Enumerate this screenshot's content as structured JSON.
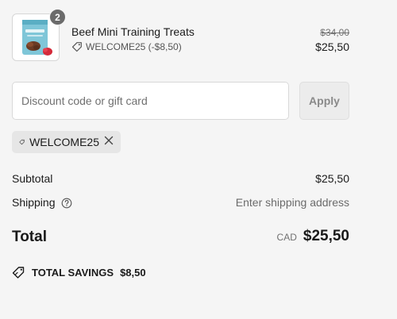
{
  "product": {
    "quantity": "2",
    "name": "Beef Mini Training Treats",
    "discount_label": "WELCOME25 (-$8,50)",
    "original_price": "$34,00",
    "price": "$25,50",
    "thumbnail_icon": "product-bag-icon"
  },
  "discount": {
    "placeholder": "Discount code or gift card",
    "value": "",
    "apply_label": "Apply"
  },
  "applied_code": {
    "code": "WELCOME25",
    "tag_icon": "tag-icon",
    "remove_icon": "close-icon"
  },
  "summary": {
    "subtotal_label": "Subtotal",
    "subtotal_value": "$25,50",
    "shipping_label": "Shipping",
    "shipping_value": "Enter shipping address",
    "total_label": "Total",
    "currency": "CAD",
    "total_value": "$25,50",
    "savings_label": "TOTAL SAVINGS",
    "savings_value": "$8,50"
  },
  "colors": {
    "background": "#f5f5f5",
    "badge": "#6b6b6b",
    "chip": "#e6e6e6",
    "muted_text": "#707070"
  }
}
